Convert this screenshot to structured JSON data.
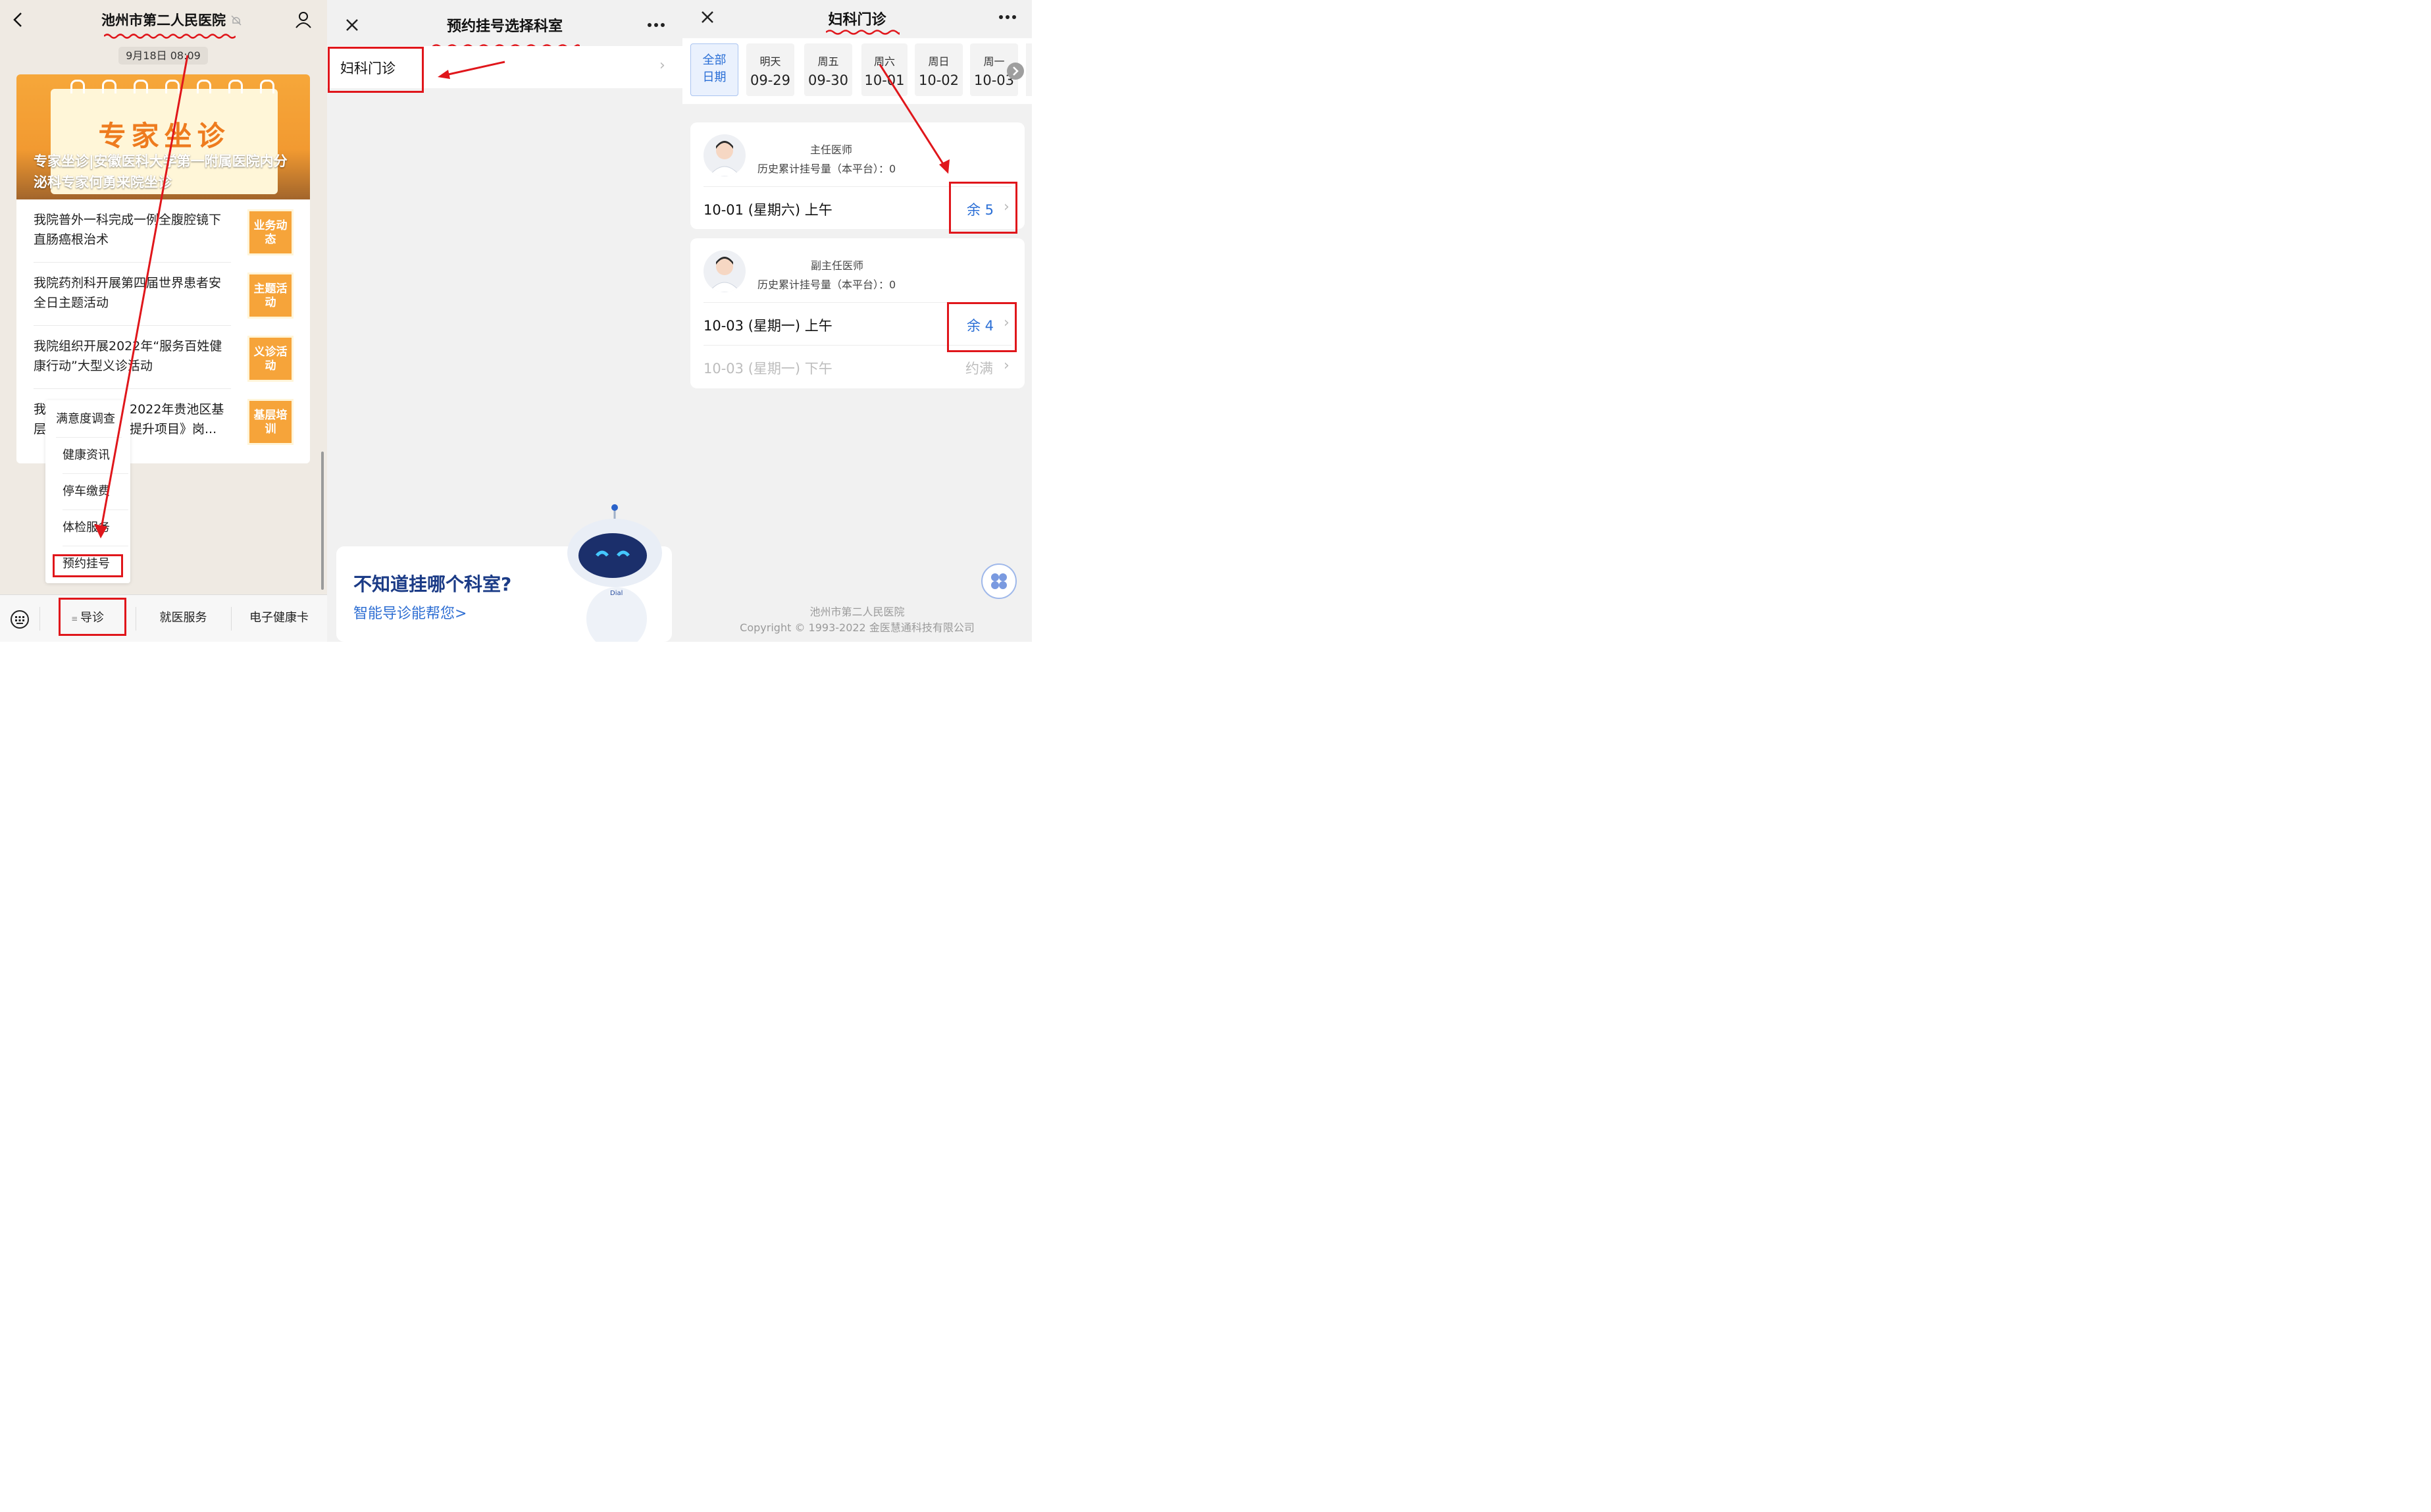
{
  "colors": {
    "annotation_red": "#e0161b",
    "accent_blue": "#2b6fd6",
    "banner_orange": "#f29a31"
  },
  "panel1": {
    "title": "池州市第二人民医院",
    "timestamp": "9月18日 08:09",
    "banner": {
      "art_text": "专家坐诊",
      "caption": "专家坐诊|安徽医科大学第一附属医院内分泌科专家何勇来院坐诊"
    },
    "news": [
      {
        "title": "我院普外一科完成一例全腹腔镜下直肠癌根治术",
        "thumb": "业务动态"
      },
      {
        "title": "我院药剂科开展第四届世界患者安全日主题活动",
        "thumb": "主题活动"
      },
      {
        "title": "我院组织开展2022年“服务百姓健康行动”大型义诊活动",
        "thumb": "义诊活动"
      },
      {
        "title_a": "我",
        "title_b": "层",
        "title_c": "2022年贵池区基",
        "title_d": "提升项目》岗...",
        "thumb": "基层培训"
      }
    ],
    "menu": [
      "满意度调查",
      "健康资讯",
      "停车缴费",
      "体检服务",
      "预约挂号"
    ],
    "bottom": {
      "guide": "导诊",
      "service": "就医服务",
      "card": "电子健康卡"
    },
    "icons": [
      "back-icon",
      "mute-icon",
      "profile-icon",
      "keyboard-icon",
      "menu-lines-icon"
    ]
  },
  "panel2": {
    "title": "预约挂号选择科室",
    "dept": "妇科门诊",
    "ai": {
      "question": "不知道挂哪个科室?",
      "link": "智能导诊能帮您>"
    },
    "icons": [
      "close-icon",
      "more-icon",
      "chevron-right-icon",
      "robot-mascot-icon"
    ]
  },
  "panel3": {
    "title": "妇科门诊",
    "dates": [
      {
        "w": "全部",
        "d": "日期"
      },
      {
        "w": "明天",
        "d": "09-29"
      },
      {
        "w": "周五",
        "d": "09-30"
      },
      {
        "w": "周六",
        "d": "10-01"
      },
      {
        "w": "周日",
        "d": "10-02"
      },
      {
        "w": "周一",
        "d": "10-03"
      }
    ],
    "doctors": [
      {
        "title": "主任医师",
        "history": "历史累计挂号量（本平台）：0",
        "slots": [
          {
            "text": "10-01 (星期六)  上午",
            "status": "余 5"
          }
        ]
      },
      {
        "title": "副主任医师",
        "history": "历史累计挂号量（本平台）：0",
        "slots": [
          {
            "text": "10-03 (星期一)  上午",
            "status": "余 4"
          },
          {
            "text": "10-03 (星期一)  下午",
            "status": "约满"
          }
        ]
      }
    ],
    "footer": {
      "org": "池州市第二人民医院",
      "copyright": "Copyright © 1993-2022 金医慧通科技有限公司"
    },
    "icons": [
      "close-icon",
      "more-icon",
      "next-arrow-icon",
      "clover-fab-icon",
      "doctor-avatar-icon"
    ]
  }
}
